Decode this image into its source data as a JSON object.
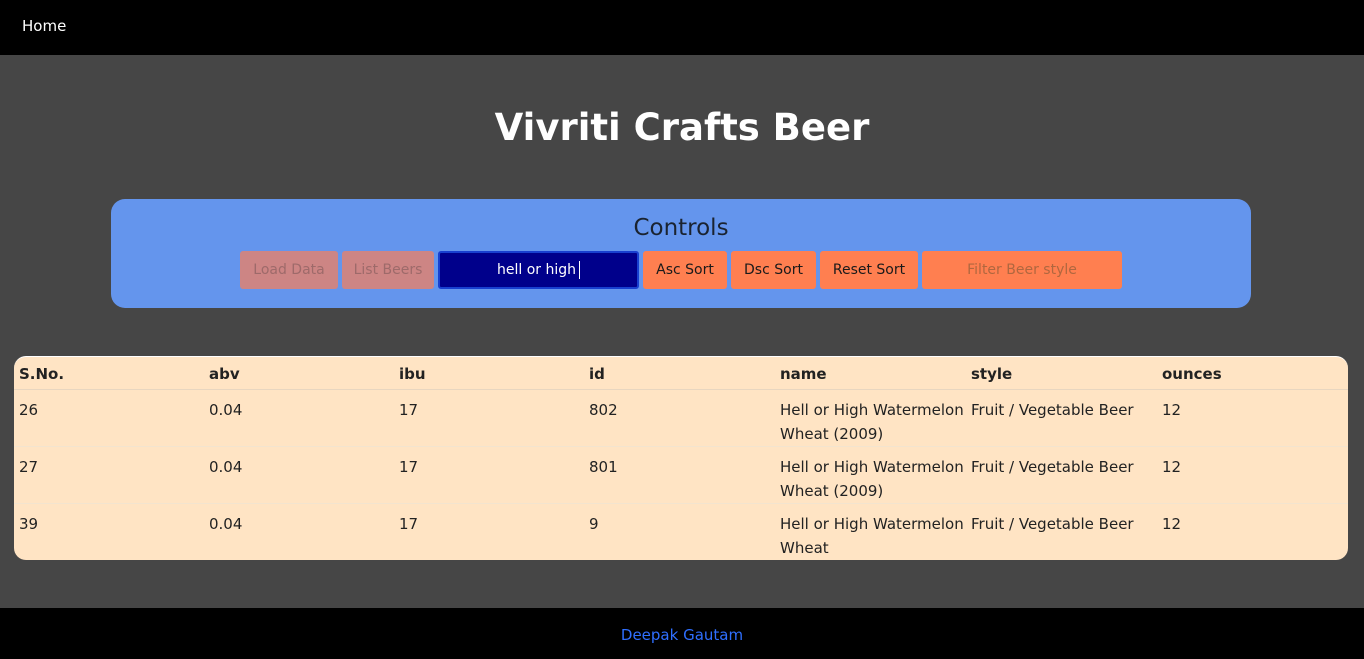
{
  "nav": {
    "home_label": "Home"
  },
  "page": {
    "title": "Vivriti Crafts Beer"
  },
  "controls": {
    "title": "Controls",
    "load_data_label": "Load Data",
    "list_beers_label": "List Beers",
    "search_value": "hell or high",
    "asc_sort_label": "Asc Sort",
    "dsc_sort_label": "Dsc Sort",
    "reset_sort_label": "Reset Sort",
    "filter_placeholder": "Filter Beer style"
  },
  "table": {
    "headers": [
      "S.No.",
      "abv",
      "ibu",
      "id",
      "name",
      "style",
      "ounces"
    ],
    "rows": [
      [
        "26",
        "0.04",
        "17",
        "802",
        "Hell or High Watermelon Wheat (2009)",
        "Fruit / Vegetable Beer",
        "12"
      ],
      [
        "27",
        "0.04",
        "17",
        "801",
        "Hell or High Watermelon Wheat (2009)",
        "Fruit / Vegetable Beer",
        "12"
      ],
      [
        "39",
        "0.04",
        "17",
        "9",
        "Hell or High Watermelon Wheat",
        "Fruit / Vegetable Beer",
        "12"
      ]
    ]
  },
  "footer": {
    "author_link": "Deepak Gautam"
  },
  "colors": {
    "background": "#464646",
    "controls_card": "#6495ed",
    "button_active": "#ff7f50",
    "button_disabled": "#cd8584",
    "search_bg": "#00008b",
    "table_bg": "#ffe4c4",
    "footer_link": "#2f6fff"
  }
}
